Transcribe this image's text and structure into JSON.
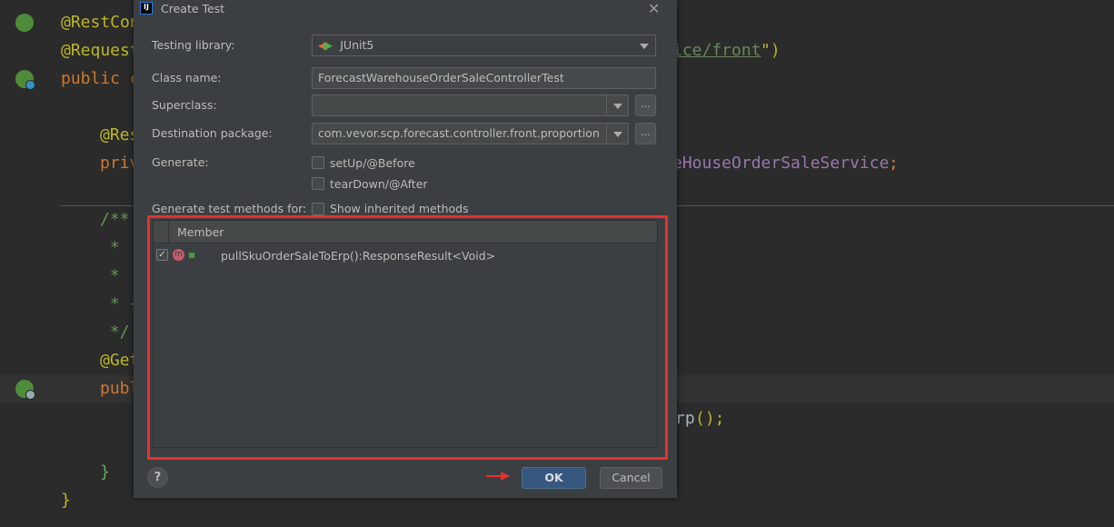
{
  "editor": {
    "lines": [
      {
        "left": "@RestCon",
        "right": ""
      },
      {
        "left": "@Request",
        "right": "ice/front",
        "right_tail": "\")"
      },
      {
        "left": "public c"
      },
      {
        "left": "@Res"
      },
      {
        "left": "priv",
        "right": "eHouseOrderSaleService",
        "right_tail": ";"
      },
      {
        "left": "/**"
      },
      {
        "left": " * "
      },
      {
        "left": " *"
      },
      {
        "left": " * {"
      },
      {
        "left": " */"
      },
      {
        "left": "@Get"
      },
      {
        "left": "publ"
      },
      {
        "right": "rp",
        "right_tail": "();"
      },
      {
        "left": "}"
      },
      {
        "left": "}"
      }
    ]
  },
  "dialog": {
    "title": "Create Test",
    "testing_library_label": "Testing library:",
    "testing_library_value": "JUnit5",
    "class_name_label": "Class name:",
    "class_name_value": "ForecastWarehouseOrderSaleControllerTest",
    "superclass_label": "Superclass:",
    "superclass_value": "",
    "destination_label": "Destination package:",
    "destination_value": "com.vevor.scp.forecast.controller.front.proportion",
    "browse_label": "...",
    "generate_label": "Generate:",
    "setup_label": "setUp/@Before",
    "teardown_label": "tearDown/@After",
    "methods_for_label": "Generate test methods for:",
    "show_inherited_label": "Show inherited methods",
    "table_header": "Member",
    "members": [
      {
        "checked": true,
        "badge": "m",
        "signature": "pullSkuOrderSaleToErp():ResponseResult<Void>"
      }
    ],
    "help_label": "?",
    "ok_label": "OK",
    "cancel_label": "Cancel"
  },
  "colors": {
    "highlight_box": "#e8302f",
    "ok_button": "#365880",
    "annotation": "#bbb529",
    "keyword": "#cc7832"
  }
}
